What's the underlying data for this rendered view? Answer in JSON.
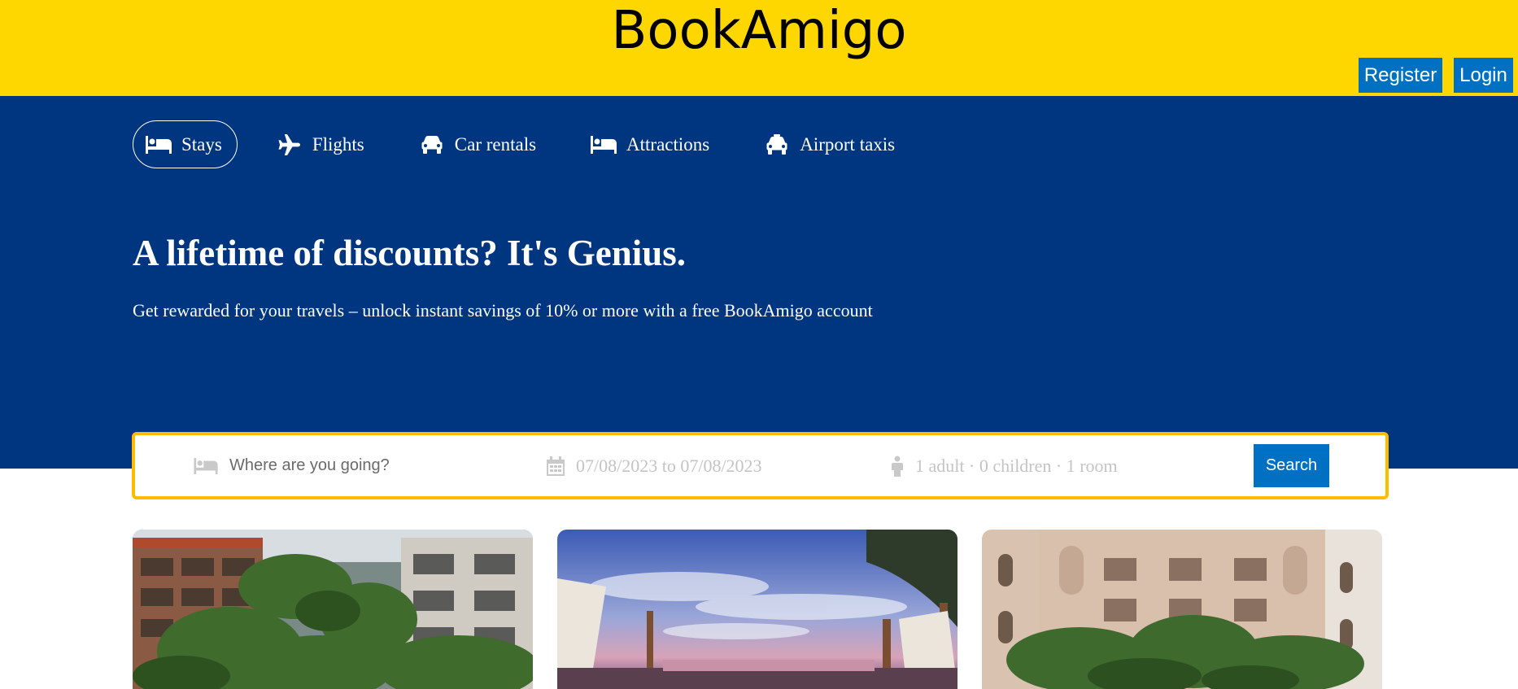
{
  "header": {
    "brand": "BookAmigo",
    "register_label": "Register",
    "login_label": "Login",
    "bg_color": "#ffd700"
  },
  "nav": {
    "items": [
      {
        "label": "Stays",
        "icon": "bed-icon",
        "active": true
      },
      {
        "label": "Flights",
        "icon": "airplane-icon",
        "active": false
      },
      {
        "label": "Car rentals",
        "icon": "car-icon",
        "active": false
      },
      {
        "label": "Attractions",
        "icon": "bed-icon",
        "active": false
      },
      {
        "label": "Airport taxis",
        "icon": "taxi-icon",
        "active": false
      }
    ]
  },
  "hero": {
    "headline": "A lifetime of discounts? It's Genius.",
    "subline": "Get rewarded for your travels – unlock instant savings of 10% or more with a free BookAmigo account",
    "bg_color": "#003580"
  },
  "search": {
    "destination_placeholder": "Where are you going?",
    "dates": "07/08/2023 to 07/08/2023",
    "guests": "1 adult · 0 children · 1 room",
    "button_label": "Search",
    "border_color": "#febb02",
    "button_color": "#0071c2"
  },
  "cards": [
    {
      "image": "resort-building-with-palms"
    },
    {
      "image": "beach-cabanas-at-sunset"
    },
    {
      "image": "hotel-courtyard-with-palms"
    }
  ]
}
